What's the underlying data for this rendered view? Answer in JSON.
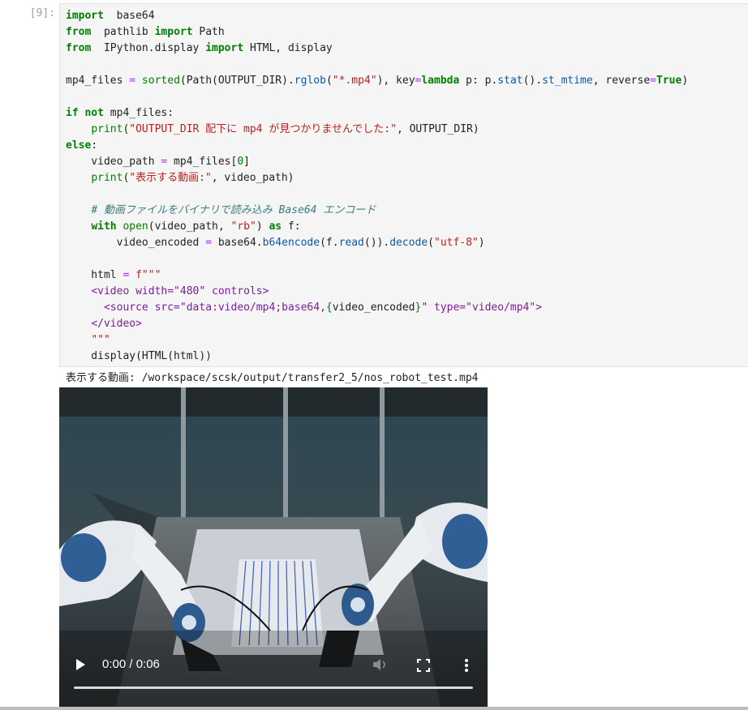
{
  "cell": {
    "prompt": "[9]:",
    "code_lines": [
      [
        [
          "kw",
          "import"
        ],
        [
          "",
          "  base64"
        ]
      ],
      [
        [
          "kw",
          "from"
        ],
        [
          "",
          "  pathlib "
        ],
        [
          "kw",
          "import"
        ],
        [
          "",
          " Path"
        ]
      ],
      [
        [
          "kw",
          "from"
        ],
        [
          "",
          "  IPython.display "
        ],
        [
          "kw",
          "import"
        ],
        [
          "",
          " HTML, display"
        ]
      ],
      [],
      [
        [
          "",
          "mp4_files "
        ],
        [
          "op",
          "="
        ],
        [
          "",
          ""
        ],
        [
          "bi",
          " sorted"
        ],
        [
          "",
          "(Path(OUTPUT_DIR)."
        ],
        [
          "at",
          "rglob"
        ],
        [
          "",
          "("
        ],
        [
          "st",
          "\"*.mp4\""
        ],
        [
          "",
          "), key"
        ],
        [
          "op",
          "="
        ],
        [
          "kw",
          "lambda"
        ],
        [
          "",
          " p: p."
        ],
        [
          "at",
          "stat"
        ],
        [
          "",
          "()."
        ],
        [
          "at",
          "st_mtime"
        ],
        [
          "",
          ", reverse"
        ],
        [
          "op",
          "="
        ],
        [
          "kw",
          "True"
        ],
        [
          "",
          ")"
        ]
      ],
      [],
      [
        [
          "kw",
          "if"
        ],
        [
          "",
          " "
        ],
        [
          "kw",
          "not"
        ],
        [
          "",
          " mp4_files:"
        ]
      ],
      [
        [
          "",
          "    "
        ],
        [
          "bi",
          "print"
        ],
        [
          "",
          "("
        ],
        [
          "st",
          "\"OUTPUT_DIR 配下に mp4 が見つかりませんでした:\""
        ],
        [
          "",
          ", OUTPUT_DIR)"
        ]
      ],
      [
        [
          "kw",
          "else"
        ],
        [
          "",
          ":"
        ]
      ],
      [
        [
          "",
          "    video_path "
        ],
        [
          "op",
          "="
        ],
        [
          "",
          " mp4_files["
        ],
        [
          "nu",
          "0"
        ],
        [
          "",
          "]"
        ]
      ],
      [
        [
          "",
          "    "
        ],
        [
          "bi",
          "print"
        ],
        [
          "",
          "("
        ],
        [
          "st",
          "\"表示する動画:\""
        ],
        [
          "",
          ", video_path)"
        ]
      ],
      [],
      [
        [
          "",
          "    "
        ],
        [
          "cm",
          "# 動画ファイルをバイナリで読み込み Base64 エンコード"
        ]
      ],
      [
        [
          "",
          "    "
        ],
        [
          "kw",
          "with"
        ],
        [
          "",
          " "
        ],
        [
          "bi",
          "open"
        ],
        [
          "",
          "(video_path, "
        ],
        [
          "st",
          "\"rb\""
        ],
        [
          "",
          ") "
        ],
        [
          "kw",
          "as"
        ],
        [
          "",
          " f:"
        ]
      ],
      [
        [
          "",
          "        video_encoded "
        ],
        [
          "op",
          "="
        ],
        [
          "",
          " base64."
        ],
        [
          "at",
          "b64encode"
        ],
        [
          "",
          "(f."
        ],
        [
          "at",
          "read"
        ],
        [
          "",
          "())."
        ],
        [
          "at",
          "decode"
        ],
        [
          "",
          "("
        ],
        [
          "st",
          "\"utf-8\""
        ],
        [
          "",
          ")"
        ]
      ],
      [],
      [
        [
          "",
          "    html "
        ],
        [
          "op",
          "="
        ],
        [
          "",
          " "
        ],
        [
          "st",
          "f\"\"\""
        ]
      ],
      [
        [
          "",
          "    "
        ],
        [
          "tg",
          "<video width=\"480\" controls>"
        ]
      ],
      [
        [
          "",
          "      "
        ],
        [
          "tg",
          "<source src=\"data:video/mp4;base64,"
        ],
        [
          "nu",
          "{"
        ],
        [
          "",
          "video_encoded"
        ],
        [
          "nu",
          "}"
        ],
        [
          "tg",
          "\" type=\"video/mp4\">"
        ]
      ],
      [
        [
          "",
          "    "
        ],
        [
          "tg",
          "</video>"
        ]
      ],
      [
        [
          "",
          "    "
        ],
        [
          "st",
          "\"\"\""
        ]
      ],
      [
        [
          "",
          "    display(HTML(html))"
        ]
      ]
    ]
  },
  "output": {
    "text": "表示する動画: /workspace/scsk/output/transfer2_5/nos_robot_test.mp4"
  },
  "video": {
    "time": "0:00 / 0:06",
    "progress": 0
  }
}
